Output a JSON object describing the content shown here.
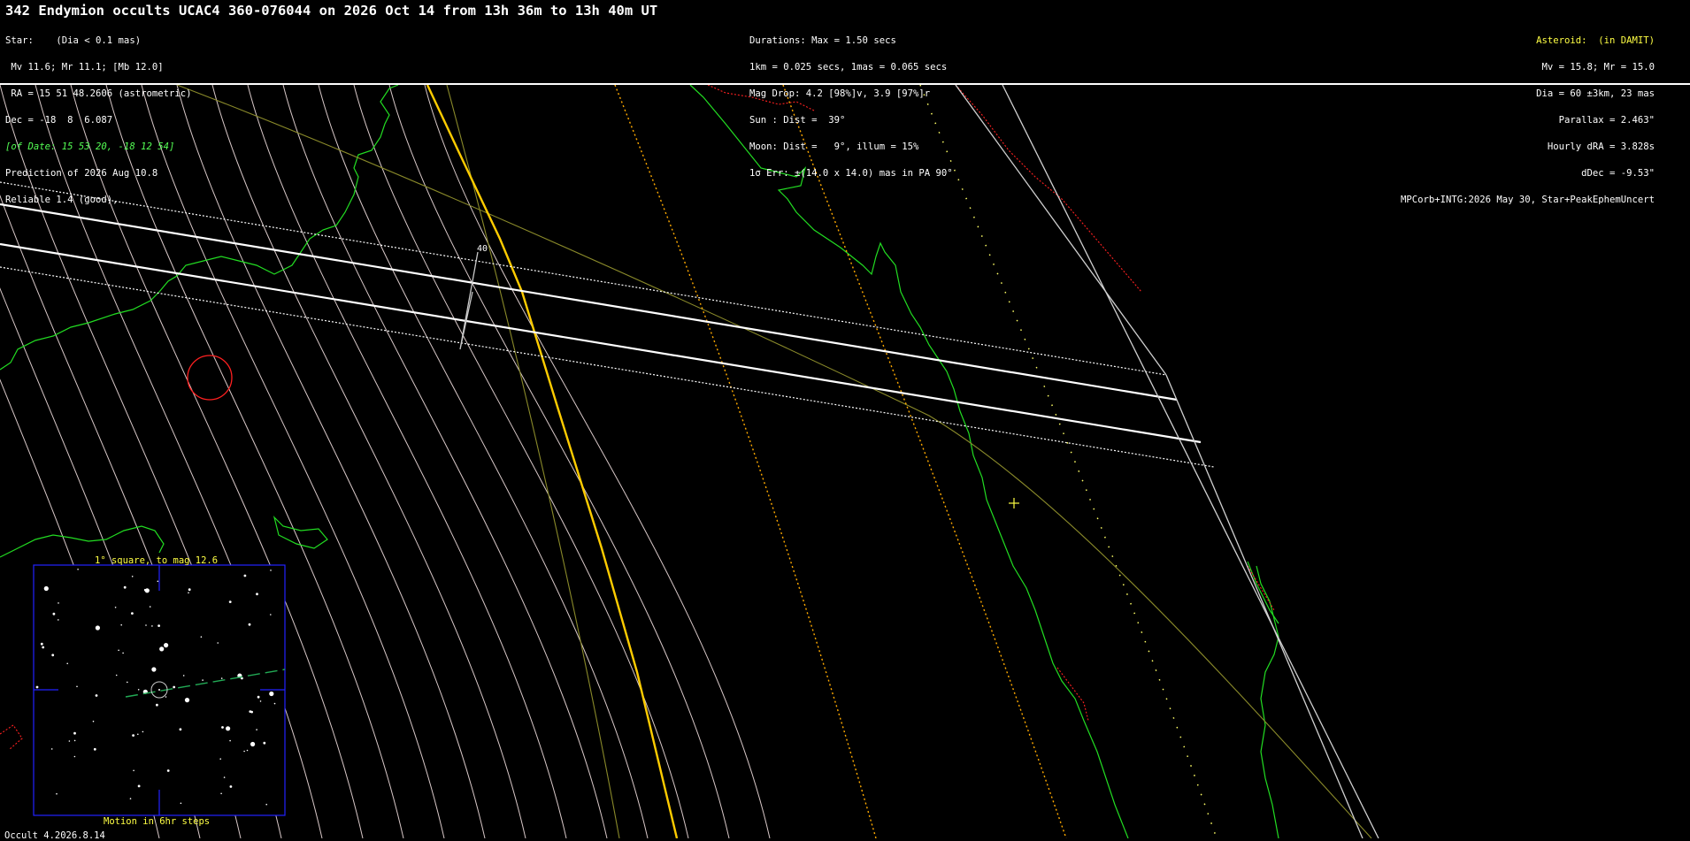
{
  "title": "342 Endymion occults UCAC4 360-076044 on 2026 Oct 14 from 13h 36m to 13h 40m UT",
  "star_info": [
    "Star:    (Dia < 0.1 mas)",
    " Mv 11.6; Mr 11.1; [Mb 12.0]",
    " RA = 15 51 48.2606 (astrometric)",
    "Dec = -18  8  6.087",
    "[of Date: 15 53 20, -18 12 54]",
    "Prediction of 2026 Aug 10.8",
    "Reliable 1.4 (good),"
  ],
  "event_info": [
    "Durations: Max = 1.50 secs",
    "1km = 0.025 secs, 1mas = 0.065 secs",
    "Mag Drop: 4.2 [98%]v, 3.9 [97%]r",
    "Sun : Dist =  39°",
    "Moon: Dist =   9°, illum = 15%",
    "1σ Err: ±(14.0 x 14.0) mas in PA 90°"
  ],
  "asteroid_info": [
    "Asteroid:  (in DAMIT)",
    "Mv = 15.8; Mr = 15.0",
    "Dia = 60 ±3km, 23 mas",
    "Parallax = 2.463\"",
    "Hourly dRA = 3.828s",
    "dDec = -9.53\"",
    "MPCorb+INTG:2026 May 30, Star+PeakEphemUncert"
  ],
  "map_label_40": "40",
  "inset": {
    "title": "1° square, to mag 12.6",
    "footer": "Motion in 6hr steps"
  },
  "version": "Occult 4.2026.8.14",
  "colors": {
    "coastline": "#22dd22",
    "path_center": "#ffffff",
    "path_limits": "#ffffff",
    "sunrise_line": "#ffcc00",
    "twilight_dotted": "#ffaa00",
    "ecliptic": "#8a8a2a",
    "red_boundary": "#ff2020",
    "longitude_lines": "#d8c8c8",
    "inset_border": "#2222ff",
    "asteroid_motion": "#22aa55"
  }
}
